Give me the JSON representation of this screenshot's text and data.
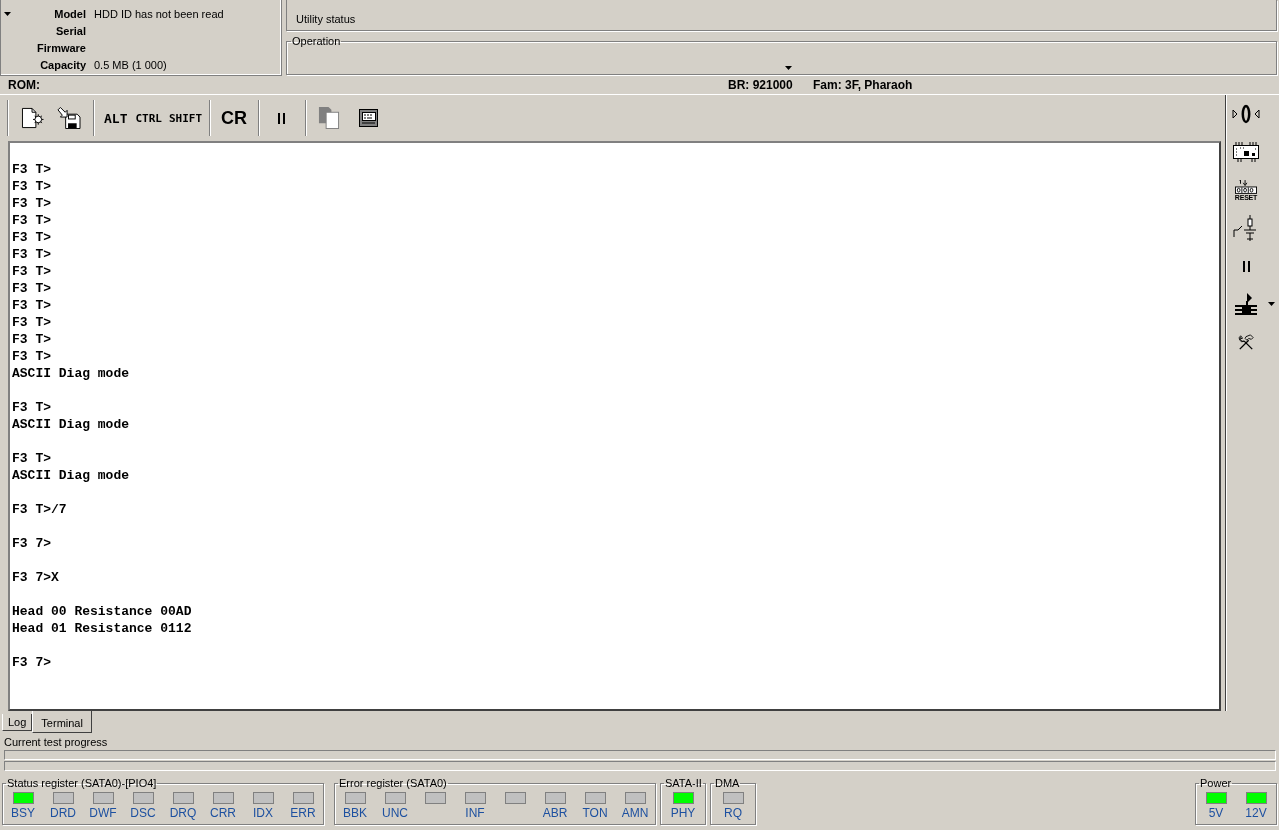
{
  "hdd": {
    "fields": [
      {
        "label": "Model",
        "value": "HDD ID has not been read"
      },
      {
        "label": "Serial"
      },
      {
        "label": "Firmware"
      },
      {
        "label": "Capacity",
        "value": "0.5 MB (1 000)"
      }
    ]
  },
  "current_test": {
    "status": "Utility status"
  },
  "operation": {
    "title": "Operation"
  },
  "info_bar": {
    "rom": "ROM:",
    "br": "BR: 921000",
    "family": "Fam: 3F, Pharaoh"
  },
  "toolbar": {
    "key_buttons": [
      "ALT",
      "CTRL",
      "SHIFT"
    ],
    "cr_button": "CR"
  },
  "side_toolbar": {
    "reset_label": "RESET"
  },
  "terminal": {
    "blocks": [
      [
        "F3 T>",
        "F3 T>",
        "F3 T>",
        "F3 T>",
        "F3 T>",
        "F3 T>",
        "F3 T>",
        "F3 T>",
        "F3 T>",
        "F3 T>",
        "F3 T>",
        "F3 T>",
        "ASCII Diag mode"
      ],
      [
        "F3 T>",
        "ASCII Diag mode"
      ],
      [
        "F3 T>",
        "ASCII Diag mode"
      ],
      [
        "F3 T>/7"
      ],
      [
        "F3 7>"
      ],
      [
        "F3 7>X"
      ],
      [
        "Head 00 Resistance 00AD",
        "Head 01 Resistance 0112"
      ],
      [
        "F3 7>"
      ]
    ]
  },
  "tabs": [
    {
      "label": "Log",
      "selected": false
    },
    {
      "label": "Terminal",
      "selected": true
    }
  ],
  "progress": {
    "label": "Current test progress"
  },
  "registers": [
    {
      "title": "Status register (SATA0)-[PIO4]",
      "leds": [
        {
          "label": "BSY",
          "on": true
        },
        {
          "label": "DRD",
          "on": false
        },
        {
          "label": "DWF",
          "on": false
        },
        {
          "label": "DSC",
          "on": false
        },
        {
          "label": "DRQ",
          "on": false
        },
        {
          "label": "CRR",
          "on": false
        },
        {
          "label": "IDX",
          "on": false
        },
        {
          "label": "ERR",
          "on": false
        }
      ]
    },
    {
      "title": "Error register (SATA0)",
      "leds": [
        {
          "label": "BBK",
          "on": false
        },
        {
          "label": "UNC",
          "on": false
        },
        {
          "on": false
        },
        {
          "label": "INF",
          "on": false
        },
        {
          "on": false
        },
        {
          "label": "ABR",
          "on": false
        },
        {
          "label": "TON",
          "on": false
        },
        {
          "label": "AMN",
          "on": false
        }
      ]
    },
    {
      "title": "SATA-II",
      "leds": [
        {
          "label": "PHY",
          "on": true
        }
      ]
    },
    {
      "title": "DMA",
      "leds": [
        {
          "label": "RQ",
          "on": false
        }
      ]
    }
  ],
  "power": {
    "title": "Power",
    "leds": [
      {
        "label": "5V",
        "on": true
      },
      {
        "label": "12V",
        "on": true
      }
    ]
  }
}
